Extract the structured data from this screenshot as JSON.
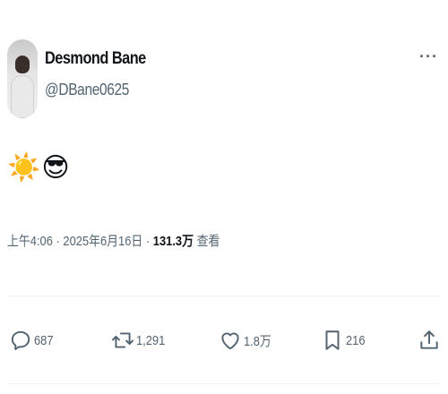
{
  "author": {
    "display_name": "Desmond Bane",
    "handle": "@DBane0625",
    "avatar_icon": "avatar-photo"
  },
  "more_label": "···",
  "content": {
    "emojis": [
      "☀️",
      "😎"
    ]
  },
  "meta": {
    "time": "上午4:06",
    "sep1": " · ",
    "date": "2025年6月16日",
    "sep2": " · ",
    "views": "131.3万",
    "views_label": " 查看"
  },
  "actions": {
    "reply": {
      "icon": "reply-icon",
      "count": "687"
    },
    "retweet": {
      "icon": "retweet-icon",
      "count": "1,291"
    },
    "like": {
      "icon": "heart-icon",
      "count": "1.8万"
    },
    "bookmark": {
      "icon": "bookmark-icon",
      "count": "216"
    },
    "share": {
      "icon": "share-icon"
    }
  },
  "colors": {
    "secondary_text": "#536471",
    "primary_text": "#0f1419",
    "divider": "#eff3f4"
  }
}
